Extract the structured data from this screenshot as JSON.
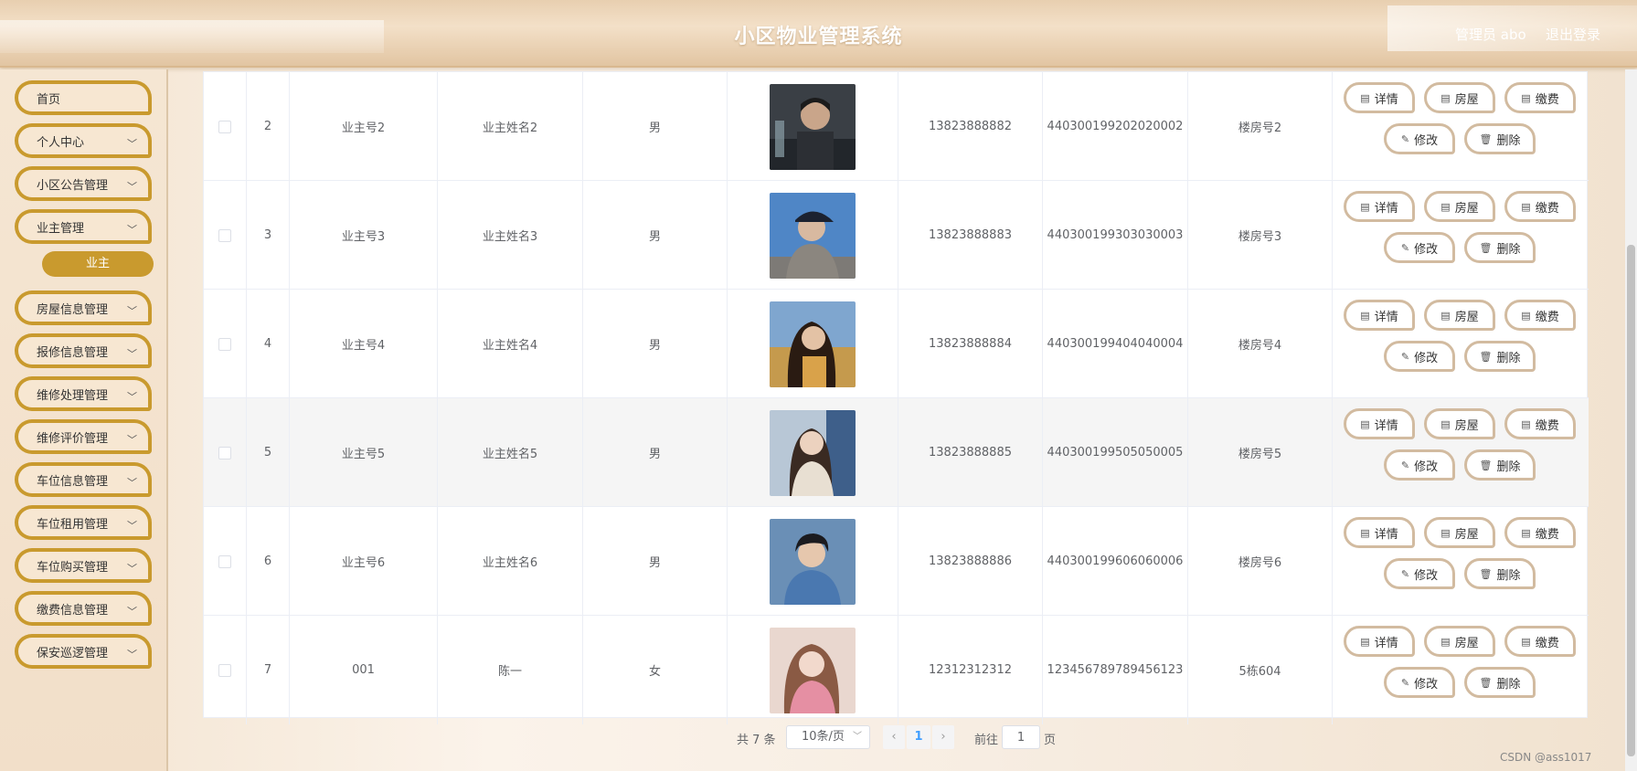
{
  "header": {
    "title": "小区物业管理系统",
    "admin": "管理员 abo",
    "logout": "退出登录"
  },
  "sidebar": {
    "items": [
      {
        "label": "首页",
        "chevron": false
      },
      {
        "label": "个人中心",
        "chevron": true
      },
      {
        "label": "小区公告管理",
        "chevron": true
      },
      {
        "label": "业主管理",
        "chevron": true
      },
      {
        "label": "房屋信息管理",
        "chevron": true
      },
      {
        "label": "报修信息管理",
        "chevron": true
      },
      {
        "label": "维修处理管理",
        "chevron": true
      },
      {
        "label": "维修评价管理",
        "chevron": true
      },
      {
        "label": "车位信息管理",
        "chevron": true
      },
      {
        "label": "车位租用管理",
        "chevron": true
      },
      {
        "label": "车位购买管理",
        "chevron": true
      },
      {
        "label": "缴费信息管理",
        "chevron": true
      },
      {
        "label": "保安巡逻管理",
        "chevron": true
      }
    ],
    "active_sub": "业主"
  },
  "table": {
    "rows": [
      {
        "index": "2",
        "owner_no": "业主号2",
        "owner_name": "业主姓名2",
        "gender": "男",
        "phone": "13823888882",
        "id_card": "440300199202020002",
        "building": "楼房号2"
      },
      {
        "index": "3",
        "owner_no": "业主号3",
        "owner_name": "业主姓名3",
        "gender": "男",
        "phone": "13823888883",
        "id_card": "440300199303030003",
        "building": "楼房号3"
      },
      {
        "index": "4",
        "owner_no": "业主号4",
        "owner_name": "业主姓名4",
        "gender": "男",
        "phone": "13823888884",
        "id_card": "440300199404040004",
        "building": "楼房号4"
      },
      {
        "index": "5",
        "owner_no": "业主号5",
        "owner_name": "业主姓名5",
        "gender": "男",
        "phone": "13823888885",
        "id_card": "440300199505050005",
        "building": "楼房号5"
      },
      {
        "index": "6",
        "owner_no": "业主号6",
        "owner_name": "业主姓名6",
        "gender": "男",
        "phone": "13823888886",
        "id_card": "440300199606060006",
        "building": "楼房号6"
      },
      {
        "index": "7",
        "owner_no": "001",
        "owner_name": "陈一",
        "gender": "女",
        "phone": "12312312312",
        "id_card": "123456789789456123",
        "building": "5栋604"
      }
    ],
    "actions": {
      "detail": "详情",
      "house": "房屋",
      "pay": "缴费",
      "edit": "修改",
      "delete": "删除"
    }
  },
  "pagination": {
    "total": "共 7 条",
    "page_size": "10条/页",
    "current_page": "1",
    "goto_label": "前往",
    "goto_value": "1",
    "page_suffix": "页"
  },
  "watermark": "CSDN @ass1017"
}
